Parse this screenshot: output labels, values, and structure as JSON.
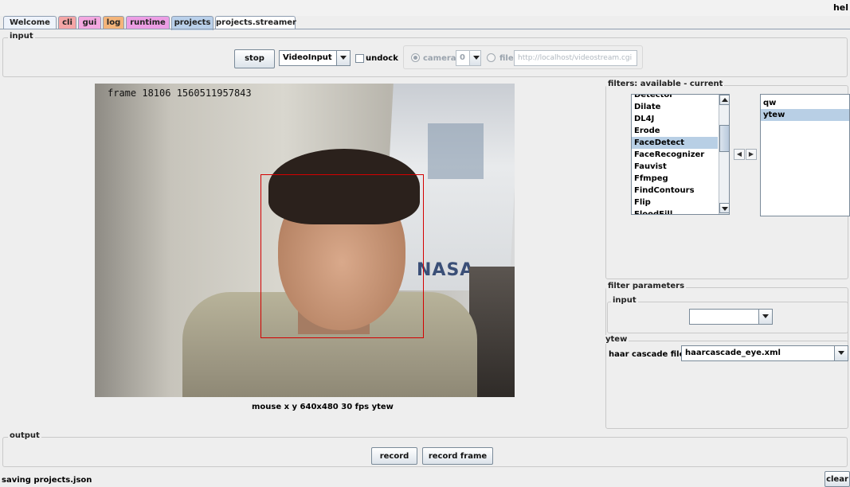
{
  "header": {
    "help_label": "hel"
  },
  "tabs": [
    {
      "label": "Welcome",
      "color": "#eef3fb"
    },
    {
      "label": "cli",
      "color": "#f4a6a6"
    },
    {
      "label": "gui",
      "color": "#f3a8e0"
    },
    {
      "label": "log",
      "color": "#f3b47a"
    },
    {
      "label": "runtime",
      "color": "#ec9ee4"
    },
    {
      "label": "projects",
      "color": "#b9d0ea",
      "active": true
    },
    {
      "label": "projects.streamer",
      "color": "#ffffff"
    }
  ],
  "input_panel": {
    "title": "input",
    "stop_label": "stop",
    "source_selected": "VideoInput",
    "undock_label": "undock",
    "undock_checked": false,
    "camera_label": "camera",
    "camera_index": "0",
    "camera_selected": true,
    "file_label": "file",
    "file_url_value": "http://localhost/videostream.cgi"
  },
  "video": {
    "frame_text": "frame 18106 1560511957843",
    "status_text": "mouse x y 640x480 30 fps ytew",
    "overlay_text": "NASA"
  },
  "filters": {
    "title": "filters: available - current",
    "available": [
      "Detector",
      "Dilate",
      "DL4J",
      "Erode",
      "FaceDetect",
      "FaceRecognizer",
      "Fauvist",
      "Ffmpeg",
      "FindContours",
      "Flip",
      "FloodFill"
    ],
    "available_selected": "FaceDetect",
    "current": [
      "qw",
      "ytew"
    ],
    "current_selected": "ytew",
    "move_left_icon": "arrow-left-icon",
    "move_right_icon": "arrow-right-icon"
  },
  "filter_parameters": {
    "title": "filter parameters",
    "input_section_title": "input",
    "input_combo_value": "",
    "ytew_section_title": "ytew",
    "haar_label": "haar cascade file",
    "haar_value": "haarcascade_eye.xml"
  },
  "output_panel": {
    "title": "output",
    "record_label": "record",
    "record_frame_label": "record frame"
  },
  "status_bar": {
    "message": "saving projects.json",
    "clear_label": "clear"
  }
}
